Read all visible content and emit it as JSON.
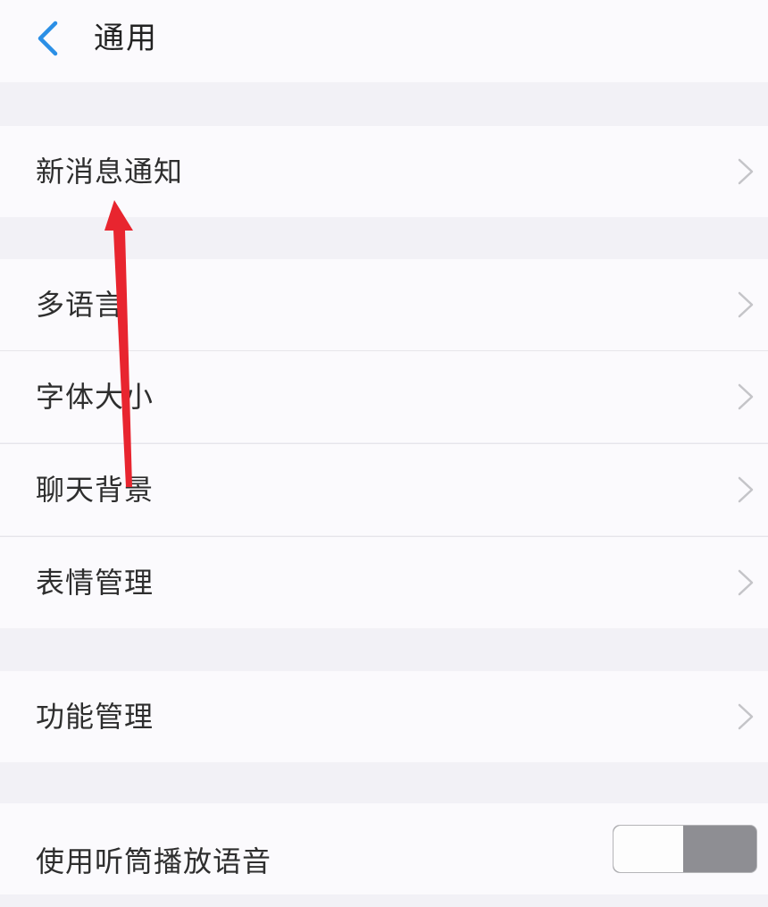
{
  "header": {
    "title": "通用",
    "back_icon": "chevron-left-icon"
  },
  "settings": {
    "items": [
      {
        "label": "新消息通知"
      },
      {
        "label": "多语言"
      },
      {
        "label": "字体大小"
      },
      {
        "label": "聊天背景"
      },
      {
        "label": "表情管理"
      },
      {
        "label": "功能管理"
      },
      {
        "label": "使用听筒播放语音"
      }
    ],
    "chevron_icon": "chevron-right-icon",
    "toggle_state": "off"
  },
  "colors": {
    "accent": "#2b8fe6",
    "annotation_arrow": "#e8252f",
    "background": "#f2f1f6",
    "row_background": "#fbfafd"
  }
}
